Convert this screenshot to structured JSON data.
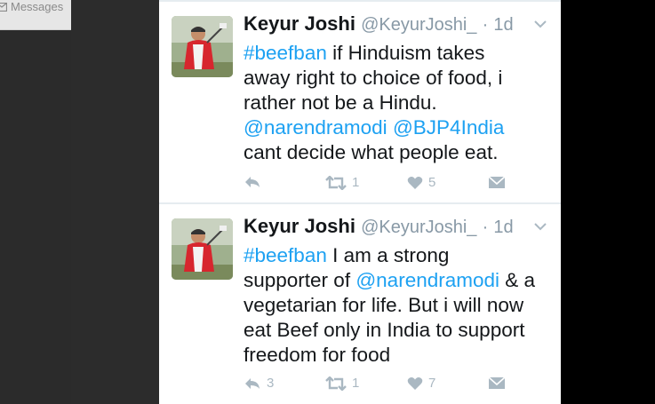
{
  "sidebar": {
    "messages_label": "Messages"
  },
  "tweets": [
    {
      "name": "Keyur Joshi",
      "handle": "@KeyurJoshi_",
      "dot": "·",
      "time": "1d",
      "lines": [
        [
          {
            "t": "#beefban",
            "link": true
          },
          {
            "t": " if Hinduism takes",
            "link": false
          }
        ],
        [
          {
            "t": "away right to choice of food, i",
            "link": false
          }
        ],
        [
          {
            "t": "rather not be a Hindu.",
            "link": false
          }
        ],
        [
          {
            "t": "@narendramodi",
            "link": true
          },
          {
            "t": " ",
            "link": false
          },
          {
            "t": "@BJP4India",
            "link": true
          }
        ],
        [
          {
            "t": "cant decide what people eat.",
            "link": false
          }
        ]
      ],
      "replies": "",
      "retweets": "1",
      "likes": "5"
    },
    {
      "name": "Keyur Joshi",
      "handle": "@KeyurJoshi_",
      "dot": "·",
      "time": "1d",
      "lines": [
        [
          {
            "t": "#beefban",
            "link": true
          },
          {
            "t": " I am a strong",
            "link": false
          }
        ],
        [
          {
            "t": "supporter of ",
            "link": false
          },
          {
            "t": "@narendramodi",
            "link": true
          },
          {
            "t": " & a",
            "link": false
          }
        ],
        [
          {
            "t": "vegetarian for life. But i will now",
            "link": false
          }
        ],
        [
          {
            "t": "eat Beef only in India to support",
            "link": false
          }
        ],
        [
          {
            "t": "freedom for food",
            "link": false
          }
        ]
      ],
      "replies": "3",
      "retweets": "1",
      "likes": "7"
    }
  ],
  "colors": {
    "link": "#1da1f2",
    "muted": "#8899a6",
    "text": "#14171a",
    "icon": "#aab8c2"
  }
}
